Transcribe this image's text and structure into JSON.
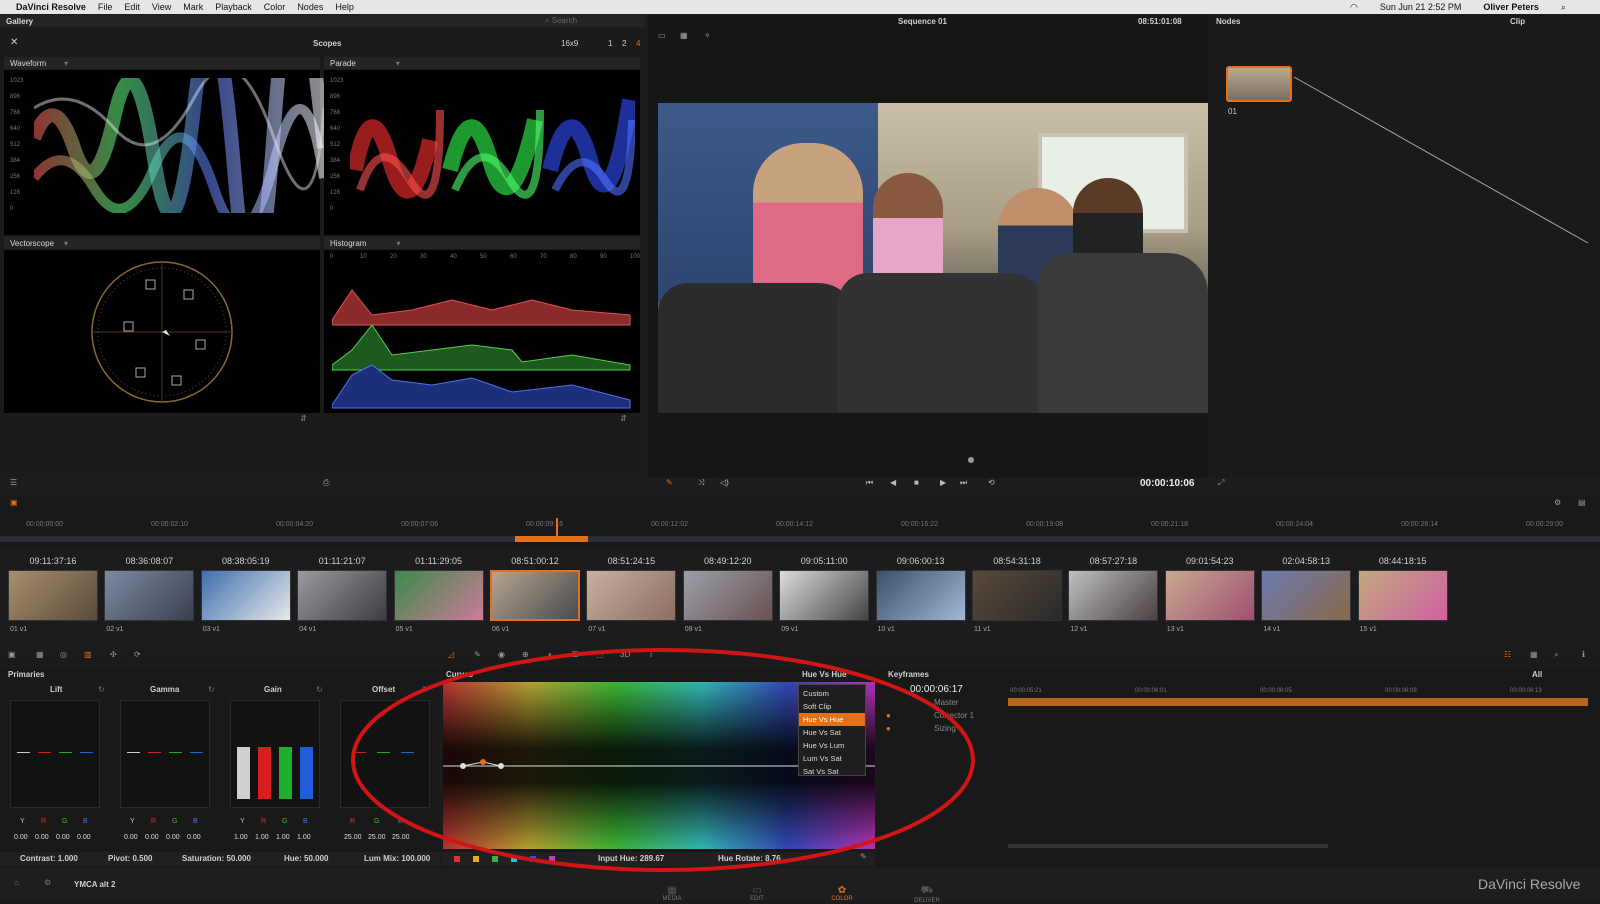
{
  "menubar": {
    "apple": "",
    "app_name": "DaVinci Resolve",
    "items": [
      "File",
      "Edit",
      "View",
      "Mark",
      "Playback",
      "Color",
      "Nodes",
      "Help"
    ],
    "clock": "Sun Jun 21  2:52 PM",
    "user": "Oliver Peters"
  },
  "top": {
    "gallery": "Gallery",
    "search_placeholder": "Search",
    "scopes_title": "Scopes",
    "layout_select": "16x9",
    "scope_counts": [
      "1",
      "2",
      "4"
    ],
    "sequence_name": "Sequence 01",
    "record_timecode": "08:51:01:08",
    "nodes_title": "Nodes",
    "clip_title": "Clip",
    "node_label": "01"
  },
  "scopes": {
    "waveform": "Waveform",
    "parade": "Parade",
    "vectorscope": "Vectorscope",
    "histogram": "Histogram",
    "waveform_ticks": [
      "1023",
      "896",
      "768",
      "640",
      "512",
      "384",
      "256",
      "128",
      "0"
    ],
    "histogram_ticks": [
      "0",
      "10",
      "20",
      "30",
      "40",
      "50",
      "60",
      "70",
      "80",
      "90",
      "100"
    ]
  },
  "viewer": {
    "timecode": "00:00:10:06"
  },
  "timeline_ruler": [
    "00:00:00:00",
    "00:00:02:10",
    "00:00:04:20",
    "00:00:07:06",
    "00:00:09:16",
    "00:00:12:02",
    "00:00:14:12",
    "00:00:16:22",
    "00:00:19:08",
    "00:00:21:18",
    "00:00:24:04",
    "00:00:26:14",
    "00:00:29:00"
  ],
  "clips": [
    {
      "tc": "09:11:37:16",
      "label": "01  v1"
    },
    {
      "tc": "08:36:08:07",
      "label": "02  v1"
    },
    {
      "tc": "08:38:05:19",
      "label": "03  v1"
    },
    {
      "tc": "01:11:21:07",
      "label": "04  v1"
    },
    {
      "tc": "01:11:29:05",
      "label": "05  v1"
    },
    {
      "tc": "08:51:00:12",
      "label": "06  v1"
    },
    {
      "tc": "08:51:24:15",
      "label": "07  v1"
    },
    {
      "tc": "08:49:12:20",
      "label": "08  v1"
    },
    {
      "tc": "09:05:11:00",
      "label": "09  v1"
    },
    {
      "tc": "09:06:00:13",
      "label": "10  v1"
    },
    {
      "tc": "08:54:31:18",
      "label": "11  v1"
    },
    {
      "tc": "08:57:27:18",
      "label": "12  v1"
    },
    {
      "tc": "09:01:54:23",
      "label": "13  v1"
    },
    {
      "tc": "02:04:58:13",
      "label": "14  v1"
    },
    {
      "tc": "08:44:18:15",
      "label": "15  v1"
    }
  ],
  "primaries": {
    "title": "Primaries",
    "wheels": [
      "Lift",
      "Gamma",
      "Gain",
      "Offset"
    ],
    "channels": [
      "Y",
      "R",
      "G",
      "B"
    ],
    "lift_vals": [
      "0.00",
      "0.00",
      "0.00",
      "0.00"
    ],
    "gamma_vals": [
      "0.00",
      "0.00",
      "0.00",
      "0.00"
    ],
    "gain_vals": [
      "1.00",
      "1.00",
      "1.00",
      "1.00"
    ],
    "offset_vals": [
      "25.00",
      "25.00",
      "25.00"
    ],
    "contrast": "Contrast: 1.000",
    "pivot": "Pivot: 0.500",
    "saturation": "Saturation: 50.000",
    "hue": "Hue: 50.000",
    "lum_mix": "Lum Mix: 100.000"
  },
  "curves": {
    "title": "Curves",
    "mode": "Hue Vs Hue",
    "menu": [
      "Custom",
      "Soft Clip",
      "Hue Vs Hue",
      "Hue Vs Sat",
      "Hue Vs Lum",
      "Lum Vs Sat",
      "Sat Vs Sat"
    ],
    "selected": "Hue Vs Hue",
    "input_hue": "Input Hue:  289.67",
    "hue_rotate": "Hue Rotate:  8.76",
    "swatch_colors": [
      "#e0302a",
      "#e0b020",
      "#40b040",
      "#30c0c0",
      "#3050e0",
      "#c040c0"
    ]
  },
  "keyframes": {
    "title": "Keyframes",
    "filter": "All",
    "timecode": "00:00:06:17",
    "tracks": [
      "Master",
      "Corrector 1",
      "Sizing"
    ],
    "ruler": [
      "00:00:05:21",
      "00:00:06:01",
      "00:00:06:05",
      "00:00:06:09",
      "00:00:06:13"
    ]
  },
  "bottom": {
    "project": "YMCA alt 2",
    "pages": [
      "MEDIA",
      "EDIT",
      "COLOR",
      "DELIVER"
    ],
    "active_page": "COLOR",
    "brand": "DaVinci Resolve"
  },
  "colors": {
    "accent": "#e3711c",
    "annotation": "#d11414"
  }
}
